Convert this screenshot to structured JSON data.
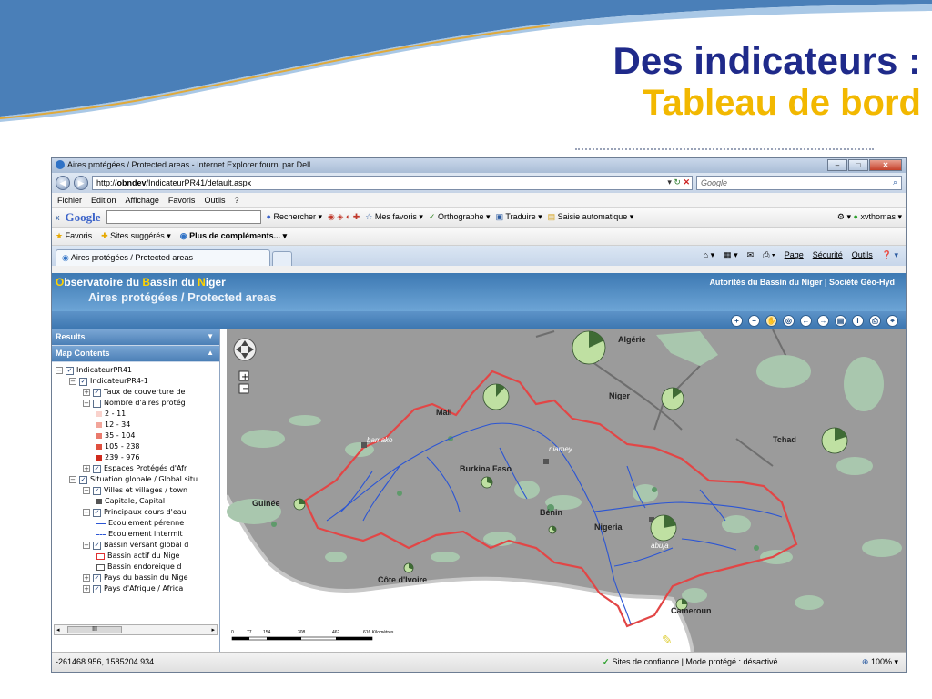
{
  "slide": {
    "title_line1": "Des indicateurs :",
    "title_line2": "Tableau de bord",
    "band_colors": [
      "#4a7fb8",
      "#a9c8e6",
      "#e0a93a"
    ]
  },
  "browser": {
    "window_title": "Aires protégées / Protected areas - Internet Explorer fourni par Dell",
    "url_prefix": "http://",
    "url_host": "obndev",
    "url_path": "/IndicateurPR41/default.aspx",
    "search_engine": "Google",
    "menu": [
      "Fichier",
      "Edition",
      "Affichage",
      "Favoris",
      "Outils",
      "?"
    ],
    "google_bar": {
      "close": "x",
      "logo": "Google",
      "search_btn": "Rechercher",
      "my_favorites": "Mes favoris",
      "spelling": "Orthographe",
      "translate": "Traduire",
      "autofill": "Saisie automatique",
      "account": "xvthomas"
    },
    "favorites_bar": {
      "favorites": "Favoris",
      "suggested": "Sites suggérés",
      "more": "Plus de compléments..."
    },
    "tab_title": "Aires protégées / Protected areas",
    "tab_tools": [
      "Page",
      "Sécurité",
      "Outils"
    ],
    "status": {
      "coords": "-261468.956, 1585204.934",
      "trust": "Sites de confiance | Mode protégé : désactivé",
      "zoom": "100%"
    }
  },
  "app": {
    "brand_o": "O",
    "brand_1": "bservatoire du ",
    "brand_b": "B",
    "brand_2": "assin du ",
    "brand_n": "N",
    "brand_3": "iger",
    "subtitle": "Aires protégées / Protected areas",
    "header_links": "Autorités du Bassin du Niger  |  Société Géo-Hyd",
    "panel_results": "Results",
    "panel_contents": "Map Contents",
    "scroll_thumb": "III"
  },
  "toc": [
    {
      "level": 0,
      "exp": "⊟",
      "check": true,
      "label": "IndicateurPR41"
    },
    {
      "level": 1,
      "exp": "⊟",
      "check": true,
      "label": "IndicateurPR4-1"
    },
    {
      "level": 2,
      "exp": "⊞",
      "check": true,
      "label": "Taux de couverture de"
    },
    {
      "level": 2,
      "exp": "⊟",
      "check": false,
      "label": "Nombre d'aires protég"
    },
    {
      "level": 3,
      "swatch": "#f9d2cc",
      "label": "2 - 11"
    },
    {
      "level": 3,
      "swatch": "#f2a59a",
      "label": "12 - 34"
    },
    {
      "level": 3,
      "swatch": "#ea7a6c",
      "label": "35 - 104"
    },
    {
      "level": 3,
      "swatch": "#e0503f",
      "label": "105 - 238"
    },
    {
      "level": 3,
      "swatch": "#cf2a1c",
      "label": "239 - 976"
    },
    {
      "level": 2,
      "exp": "⊞",
      "check": true,
      "label": "Espaces Protégés d'Afr"
    },
    {
      "level": 1,
      "exp": "⊟",
      "check": true,
      "label": "Situation globale / Global situ"
    },
    {
      "level": 2,
      "exp": "⊟",
      "check": true,
      "label": "Villes et villages / town"
    },
    {
      "level": 3,
      "swatch": "#555555",
      "label": "Capitale, Capital"
    },
    {
      "level": 2,
      "exp": "⊟",
      "check": true,
      "label": "Principaux cours d'eau"
    },
    {
      "level": 3,
      "line": "solid",
      "label": "Ecoulement pérenne"
    },
    {
      "level": 3,
      "line": "dashed",
      "label": "Ecoulement intermit"
    },
    {
      "level": 2,
      "exp": "⊟",
      "check": true,
      "label": "Bassin versant global d"
    },
    {
      "level": 3,
      "box": "#e03030",
      "label": "Bassin actif du Nige"
    },
    {
      "level": 3,
      "box": "#555555",
      "label": "Bassin endoreique d"
    },
    {
      "level": 2,
      "exp": "⊞",
      "check": true,
      "label": "Pays du bassin du Nige"
    },
    {
      "level": 2,
      "exp": "⊞",
      "check": true,
      "label": "Pays d'Afrique / Africa"
    }
  ],
  "map": {
    "labels": {
      "algerie": "Algérie",
      "mali": "Mali",
      "niger": "Niger",
      "tchad": "Tchad",
      "bamako": "bamako",
      "niamey": "niamey",
      "burkina": "Burkina Faso",
      "guinee": "Guinée",
      "benin": "Bénin",
      "nigeria": "Nigeria",
      "abuja": "abuja",
      "cote": "Côte d'Ivoire",
      "cameroun": "Cameroun"
    },
    "scale_ticks": [
      "0",
      "77",
      "154",
      "308",
      "462",
      "616 Kilomètres"
    ],
    "colors": {
      "land": "#9b9b9b",
      "ocean": "#ffffff",
      "protected": "#a9c7ae",
      "protected_dark": "#5f9a6b",
      "basin_outline": "#e24646",
      "river": "#2b55d4",
      "pie_dark": "#3f6b35",
      "pie_light": "#bfe0a2"
    },
    "pies": [
      {
        "name": "algerie",
        "share": 0.18
      },
      {
        "name": "mali",
        "share": 0.12
      },
      {
        "name": "niger",
        "share": 0.15
      },
      {
        "name": "tchad",
        "share": 0.2
      },
      {
        "name": "burkina",
        "share": 0.3
      },
      {
        "name": "guinee",
        "share": 0.25
      },
      {
        "name": "benin",
        "share": 0.35
      },
      {
        "name": "nigeria",
        "share": 0.22
      },
      {
        "name": "cote",
        "share": 0.3
      },
      {
        "name": "cameroun",
        "share": 0.25
      }
    ]
  }
}
